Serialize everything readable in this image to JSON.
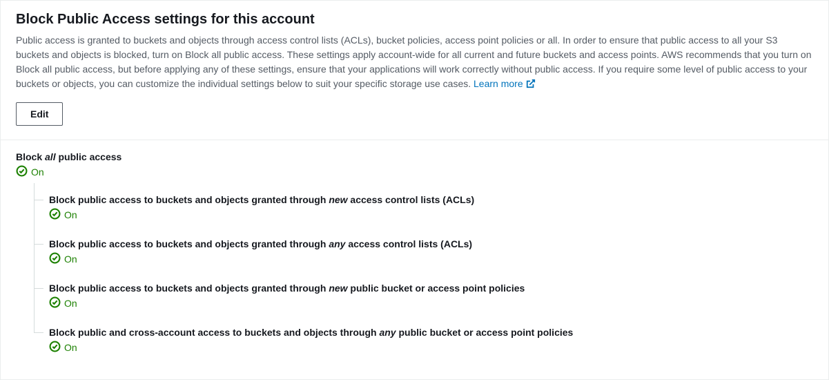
{
  "header": {
    "title": "Block Public Access settings for this account",
    "description": "Public access is granted to buckets and objects through access control lists (ACLs), bucket policies, access point policies or all. In order to ensure that public access to all your S3 buckets and objects is blocked, turn on Block all public access. These settings apply account-wide for all current and future buckets and access points. AWS recommends that you turn on Block all public access, but before applying any of these settings, ensure that your applications will work correctly without public access. If you require some level of public access to your buckets or objects, you can customize the individual settings below to suit your specific storage use cases.",
    "learn_more": "Learn more",
    "edit_label": "Edit"
  },
  "status": {
    "on": "On"
  },
  "block_all": {
    "prefix": "Block ",
    "emph": "all",
    "suffix": " public access"
  },
  "settings": [
    {
      "prefix": "Block public access to buckets and objects granted through ",
      "emph": "new",
      "suffix": " access control lists (ACLs)"
    },
    {
      "prefix": "Block public access to buckets and objects granted through ",
      "emph": "any",
      "suffix": " access control lists (ACLs)"
    },
    {
      "prefix": "Block public access to buckets and objects granted through ",
      "emph": "new",
      "suffix": " public bucket or access point policies"
    },
    {
      "prefix": "Block public and cross-account access to buckets and objects through ",
      "emph": "any",
      "suffix": " public bucket or access point policies"
    }
  ],
  "colors": {
    "success": "#1d8102",
    "link": "#0073bb"
  }
}
